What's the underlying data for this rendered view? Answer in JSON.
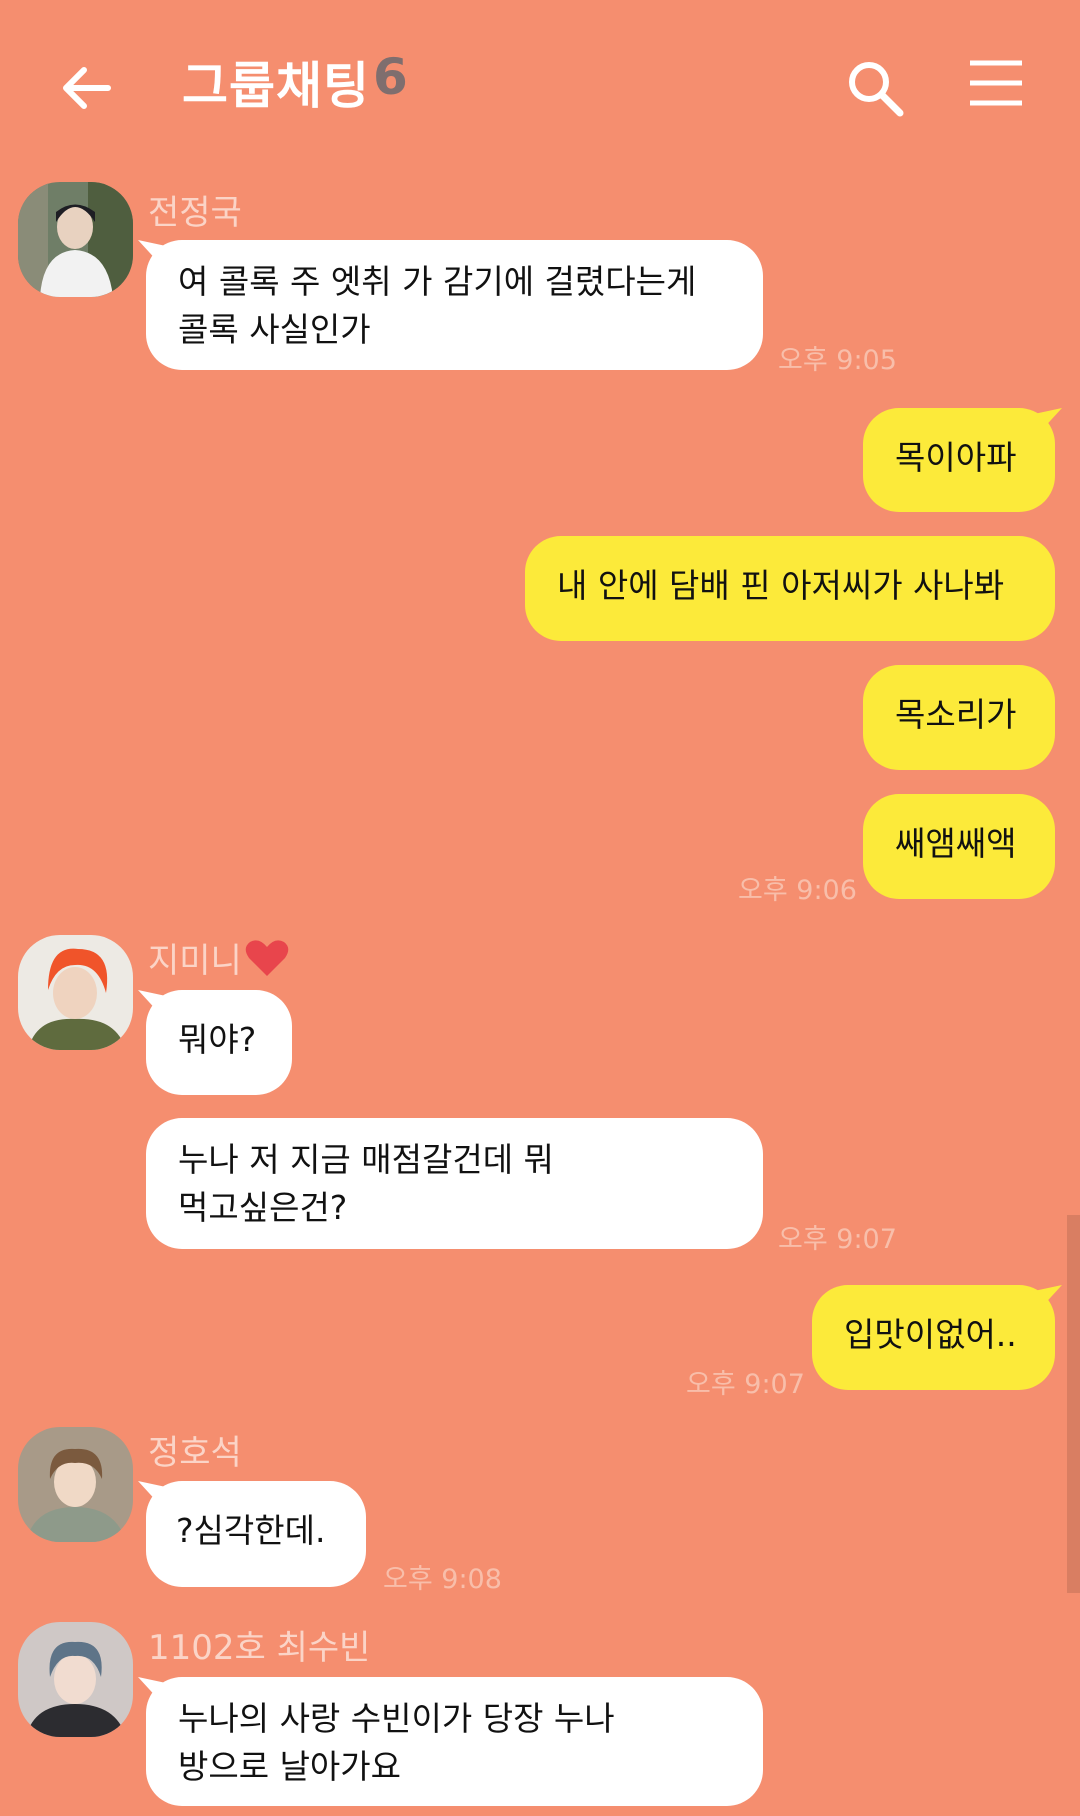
{
  "header": {
    "title": "그룹채팅",
    "member_count": "6"
  },
  "messages": [
    {
      "sender": "전정국",
      "text": "여 콜록 주 엣취 가 감기에 걸렸다는게\n콜록 사실인가",
      "time": "오후 9:05"
    },
    {
      "text": "목이아파"
    },
    {
      "text": "내 안에 담배 핀 아저씨가 사나봐"
    },
    {
      "text": "목소리가"
    },
    {
      "text": "쌔앰쌔액",
      "time": "오후 9:06"
    },
    {
      "sender": "지미니",
      "text": "뭐야?"
    },
    {
      "text": "누나 저 지금 매점갈건데 뭐\n먹고싶은건?",
      "time": "오후 9:07"
    },
    {
      "text": "입맛이없어..",
      "time": "오후 9:07"
    },
    {
      "sender": "정호석",
      "text": "?심각한데.",
      "time": "오후 9:08"
    },
    {
      "sender": "1102호 최수빈",
      "text": "누나의 사랑 수빈이가 당장 누나\n방으로 날아가요"
    }
  ],
  "icons": {
    "back": "arrow-left-icon",
    "search": "search-icon",
    "menu": "hamburger-menu-icon",
    "heart": "heart-icon"
  },
  "colors": {
    "background": "#F58E6F",
    "outgoing_bubble": "#FCEA3A",
    "incoming_bubble": "#FFFFFF",
    "member_count": "#7F6E6E"
  }
}
